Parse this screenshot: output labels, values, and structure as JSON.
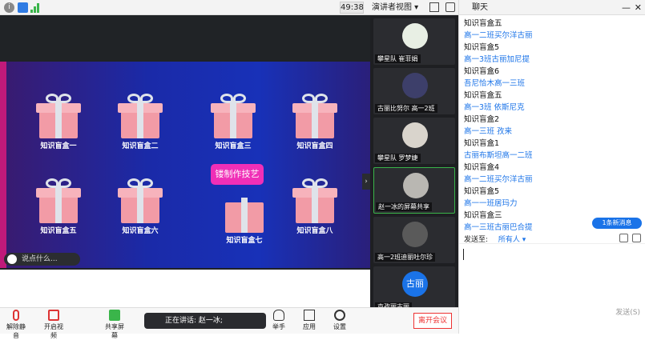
{
  "topbar": {
    "timer": "49:38",
    "view_label": "演讲者视图 ▾"
  },
  "slide": {
    "boxes": [
      {
        "label": "知识盲盒一"
      },
      {
        "label": "知识盲盒二"
      },
      {
        "label": "知识盲盒三"
      },
      {
        "label": "知识盲盒四"
      },
      {
        "label": "知识盲盒五"
      },
      {
        "label": "知识盲盒六"
      },
      {
        "label": "知识盲盒七"
      },
      {
        "label": "知识盲盒八"
      }
    ],
    "badge": "镂制作技艺",
    "comment_placeholder": "说点什么..."
  },
  "gallery": {
    "tiles": [
      {
        "name": "攀星队 崔菲娟"
      },
      {
        "name": "古丽比努尔 高一2班"
      },
      {
        "name": "攀星队 罗梦婕"
      },
      {
        "name": "赵一冰的屏幕共享"
      },
      {
        "name": "高一2班迪丽吐尔珍"
      },
      {
        "name": "克孜丽古丽",
        "avatar_text": "古丽"
      }
    ]
  },
  "toolbar": {
    "mute": "解除静音",
    "video": "开启视频",
    "share": "共享屏幕",
    "speaking": "正在讲话: 赵一冰;",
    "hand": "举手",
    "apps": "应用",
    "settings": "设置",
    "leave": "离开会议"
  },
  "chat": {
    "title": "聊天",
    "messages": [
      {
        "text": "知识盲盒五",
        "kind": "s"
      },
      {
        "text": "高一二班买尔洋古丽",
        "kind": "m"
      },
      {
        "text": "知识盲盒5",
        "kind": "s"
      },
      {
        "text": "高一3班古丽加尼提",
        "kind": "m"
      },
      {
        "text": "知识盲盒6",
        "kind": "s"
      },
      {
        "text": "吾尼恰木高一三班",
        "kind": "m"
      },
      {
        "text": "知识盲盒五",
        "kind": "s"
      },
      {
        "text": "高一3班 依斯尼克",
        "kind": "m"
      },
      {
        "text": "知识盲盒2",
        "kind": "s"
      },
      {
        "text": "高一三班 孜来",
        "kind": "m"
      },
      {
        "text": "知识盲盒1",
        "kind": "s"
      },
      {
        "text": "古丽布斯坦高一二班",
        "kind": "m"
      },
      {
        "text": "知识盲盒4",
        "kind": "s"
      },
      {
        "text": "高一二班买尔洋古丽",
        "kind": "m"
      },
      {
        "text": "知识盲盒5",
        "kind": "s"
      },
      {
        "text": "高一一班居玛力",
        "kind": "m"
      },
      {
        "text": "知识盲盒三",
        "kind": "s"
      },
      {
        "text": "高一三班古丽巴合提",
        "kind": "m"
      }
    ],
    "new_messages": "1条新消息",
    "send_to_label": "发送至:",
    "send_to_target": "所有人 ▾",
    "send_button": "发送(S)"
  }
}
